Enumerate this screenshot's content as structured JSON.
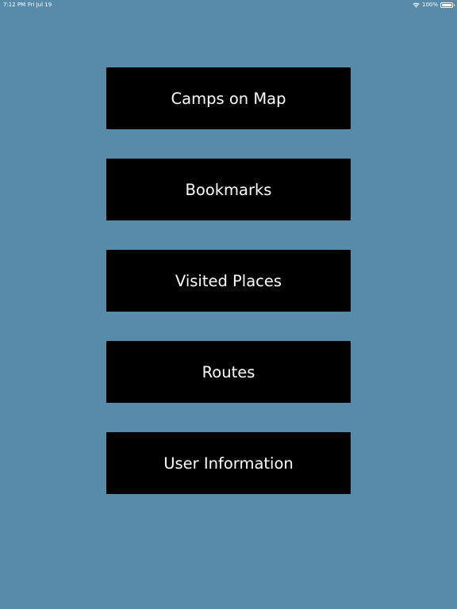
{
  "status_bar": {
    "time": "7:12 PM",
    "date": "Fri Jul 19",
    "wifi_icon": "wifi-icon",
    "battery_percent": "100%",
    "battery_icon": "battery-icon"
  },
  "menu": {
    "buttons": [
      {
        "label": "Camps on Map"
      },
      {
        "label": "Bookmarks"
      },
      {
        "label": "Visited Places"
      },
      {
        "label": "Routes"
      },
      {
        "label": "User Information"
      }
    ]
  },
  "colors": {
    "background": "#578ba9",
    "button_background": "#000000",
    "button_text": "#ffffff"
  }
}
